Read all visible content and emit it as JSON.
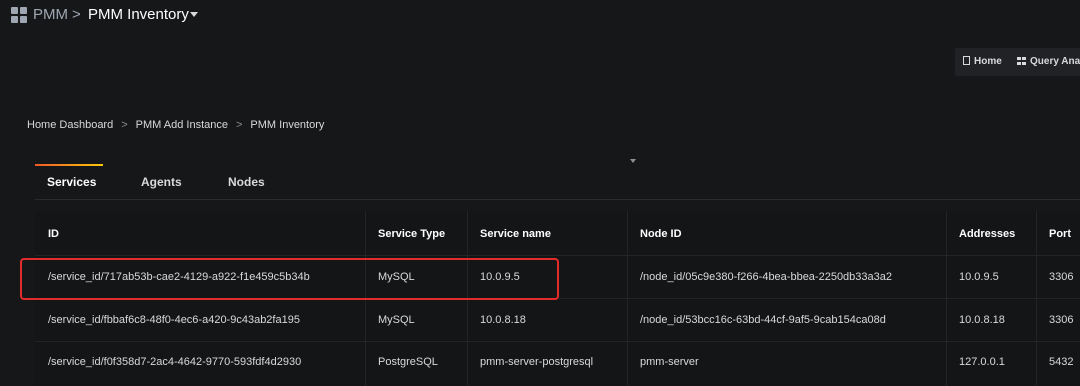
{
  "topbar": {
    "root": "PMM",
    "separator": ">",
    "title": "PMM Inventory"
  },
  "toolbar": {
    "home_label": "Home",
    "query_label": "Query Analy"
  },
  "breadcrumb": {
    "items": [
      "Home Dashboard",
      "PMM Add Instance",
      "PMM Inventory"
    ],
    "separator": ">"
  },
  "tabs": [
    {
      "label": "Services",
      "active": true
    },
    {
      "label": "Agents",
      "active": false
    },
    {
      "label": "Nodes",
      "active": false
    }
  ],
  "table": {
    "headers": [
      "ID",
      "Service Type",
      "Service name",
      "Node ID",
      "Addresses",
      "Port"
    ],
    "rows": [
      [
        "/service_id/717ab53b-cae2-4129-a922-f1e459c5b34b",
        "MySQL",
        "10.0.9.5",
        "/node_id/05c9e380-f266-4bea-bbea-2250db33a3a2",
        "10.0.9.5",
        "3306"
      ],
      [
        "/service_id/fbbaf6c8-48f0-4ec6-a420-9c43ab2fa195",
        "MySQL",
        "10.0.8.18",
        "/node_id/53bcc16c-63bd-44cf-9af5-9cab154ca08d",
        "10.0.8.18",
        "3306"
      ],
      [
        "/service_id/f0f358d7-2ac4-4642-9770-593fdf4d2930",
        "PostgreSQL",
        "pmm-server-postgresql",
        "pmm-server",
        "127.0.0.1",
        "5432"
      ]
    ]
  },
  "colors": {
    "background": "#161719",
    "highlight": "#e32b2b",
    "tab_accent_start": "#f05a28",
    "tab_accent_end": "#fbca0a"
  }
}
